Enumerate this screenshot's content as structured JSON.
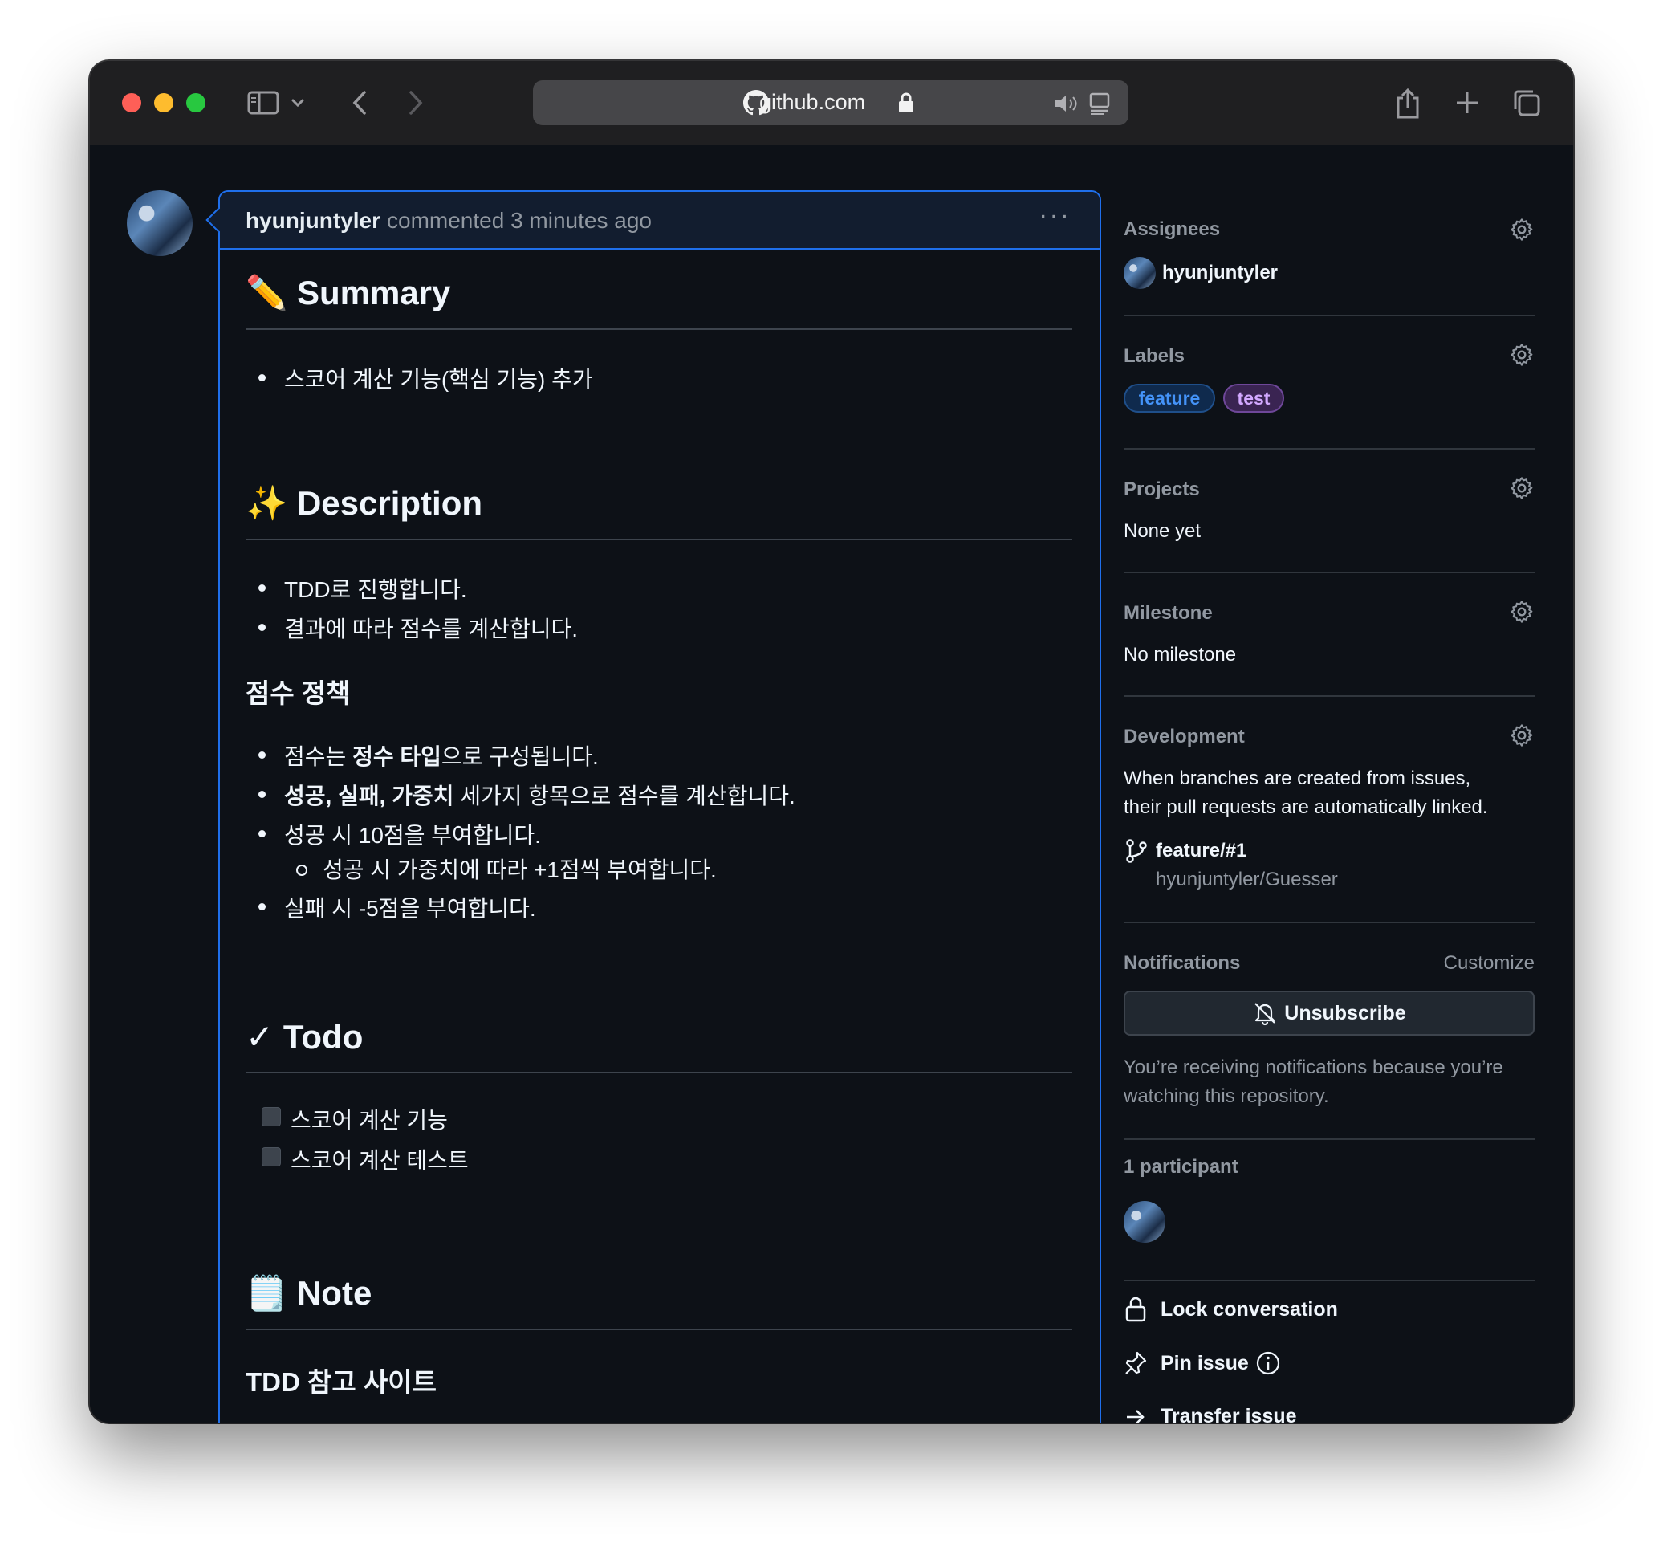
{
  "browser": {
    "url": "github.com",
    "colors": {
      "close": "#fe5f57",
      "minimize": "#febc2e",
      "maximize": "#28c840"
    }
  },
  "comment": {
    "author": "hyunjuntyler",
    "meta": "commented 3 minutes ago",
    "more": "···",
    "summary": {
      "emoji": "✏️",
      "heading": "Summary",
      "items": [
        "스코어 계산 기능(핵심 기능) 추가"
      ]
    },
    "description": {
      "emoji": "✨",
      "heading": "Description",
      "items": [
        "TDD로 진행합니다.",
        "결과에 따라 점수를 계산합니다."
      ]
    },
    "policy": {
      "heading": "점수 정책",
      "item1_pre": "점수는 ",
      "item1_bold": "정수 타입",
      "item1_post": "으로 구성됩니다.",
      "item2_bold": "성공, 실패, 가중치",
      "item2_post": " 세가지 항목으로 점수를 계산합니다.",
      "item3": "성공 시 10점을 부여합니다.",
      "item3_sub": "성공 시 가중치에 따라 +1점씩 부여합니다.",
      "item4": "실패 시 -5점을 부여합니다."
    },
    "todo": {
      "emoji": "✓",
      "heading": "Todo",
      "items": [
        "스코어 계산 기능",
        "스코어 계산 테스트"
      ]
    },
    "note": {
      "emoji": "🗒️",
      "heading": "Note",
      "subheading": "TDD 참고 사이트"
    }
  },
  "sidebar": {
    "assignees": {
      "title": "Assignees",
      "user": "hyunjuntyler"
    },
    "labels": {
      "title": "Labels",
      "items": [
        {
          "name": "feature",
          "color": "#4493f8"
        },
        {
          "name": "test",
          "color": "#d2a8ff"
        }
      ]
    },
    "projects": {
      "title": "Projects",
      "value": "None yet"
    },
    "milestone": {
      "title": "Milestone",
      "value": "No milestone"
    },
    "development": {
      "title": "Development",
      "text1": "When branches are created from issues,",
      "text2": "their pull requests are automatically linked.",
      "branch": "feature/#1",
      "repo": "hyunjuntyler/Guesser"
    },
    "notifications": {
      "title": "Notifications",
      "customize": "Customize",
      "button": "Unsubscribe",
      "text1": "You’re receiving notifications because you’re",
      "text2": "watching this repository."
    },
    "participants": {
      "title": "1 participant"
    },
    "actions": {
      "lock": "Lock conversation",
      "pin": "Pin issue",
      "transfer": "Transfer issue"
    }
  }
}
